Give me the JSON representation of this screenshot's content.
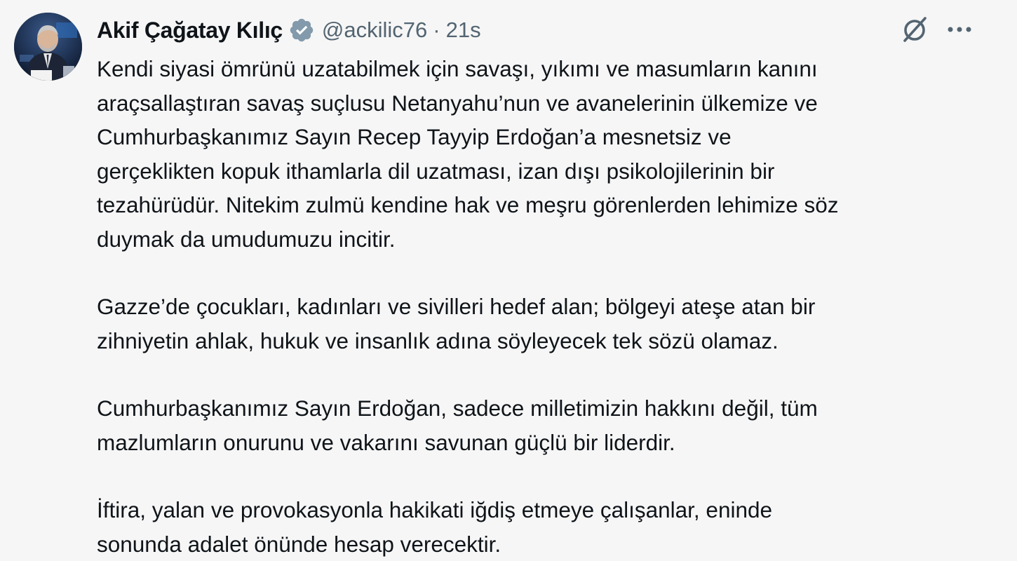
{
  "author": {
    "name": "Akif Çağatay Kılıç",
    "handle": "@ackilic76",
    "separator": "·",
    "time": "21s",
    "verified": true,
    "badge_color": "#829aab",
    "avatar_icon": "profile-photo"
  },
  "actions": {
    "grok_icon": "grok-icon",
    "more_icon": "more-horizontal-icon"
  },
  "paragraphs": [
    "Kendi siyasi ömrünü uzatabilmek için savaşı, yıkımı ve masumların kanını\naraçsallaştıran savaş suçlusu Netanyahu’nun ve avanelerinin ülkemize ve\nCumhurbaşkanımız Sayın Recep Tayyip Erdoğan’a mesnetsiz ve\ngerçeklikten kopuk ithamlarla dil uzatması, izan dışı psikolojilerinin bir\ntezahürüdür. Nitekim zulmü kendine hak ve meşru görenlerden lehimize söz\nduymak da umudumuzu incitir.",
    "Gazze’de çocukları, kadınları ve sivilleri hedef alan; bölgeyi ateşe atan bir\nzihniyetin ahlak, hukuk ve insanlık adına söyleyecek tek sözü olamaz.",
    "Cumhurbaşkanımız Sayın Erdoğan, sadece milletimizin hakkını değil, tüm\nmazlumların onurunu ve vakarını savunan güçlü bir liderdir.",
    "İftira, yalan ve provokasyonla hakikati iğdiş etmeye çalışanlar, eninde\nsonunda adalet önünde hesap verecektir."
  ]
}
